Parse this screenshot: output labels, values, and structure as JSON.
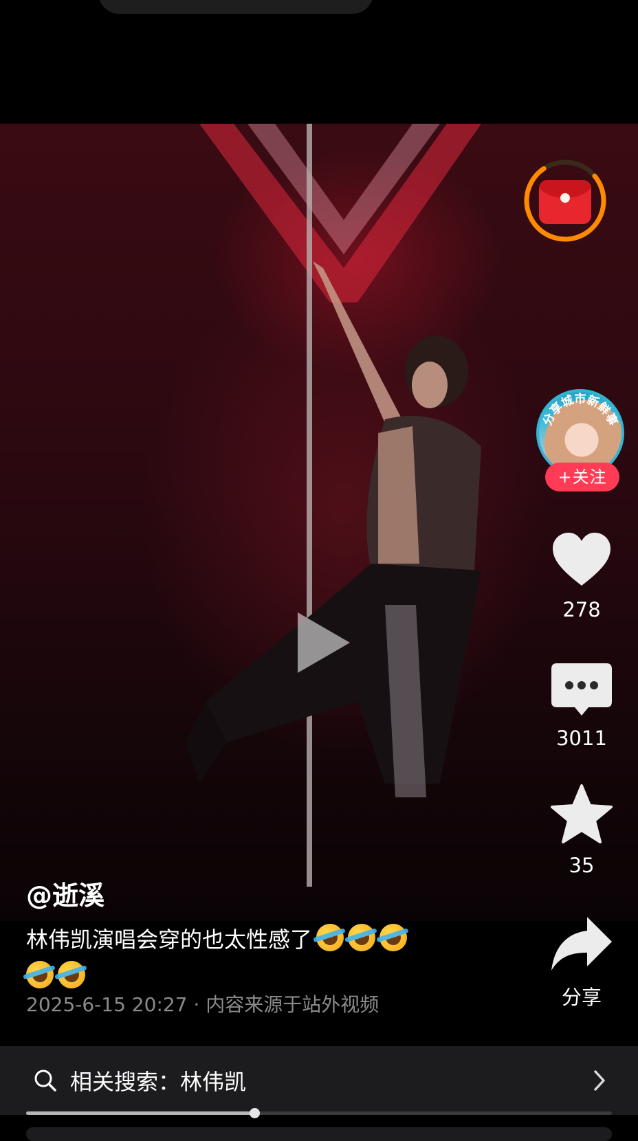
{
  "author": "@逝溪",
  "caption": {
    "text": "林伟凯演唱会穿的也太性感了",
    "emoji_row1_count": 3,
    "emoji_row2_count": 2,
    "emoji_name": "rolling-on-floor-laughing"
  },
  "meta": {
    "datetime": "2025-6-15 20:27",
    "separator": "·",
    "source": "内容来源于站外视频"
  },
  "side": {
    "follow_badge_text": "分享城市新鲜事",
    "follow_label": "+关注",
    "like_count": "278",
    "comment_count": "3011",
    "favorite_count": "35",
    "share_label": "分享"
  },
  "search": {
    "label": "相关搜索：",
    "query": "林伟凯"
  },
  "playback": {
    "progress_fraction": 0.39
  },
  "colors": {
    "follow_button": "#ff3b55",
    "redpacket_ring": "#ff8a00",
    "redpacket": "#e8262d"
  },
  "icons": [
    "redpacket-icon",
    "play-icon",
    "heart-icon",
    "comment-icon",
    "star-icon",
    "share-icon",
    "search-icon",
    "chevron-right-icon"
  ]
}
